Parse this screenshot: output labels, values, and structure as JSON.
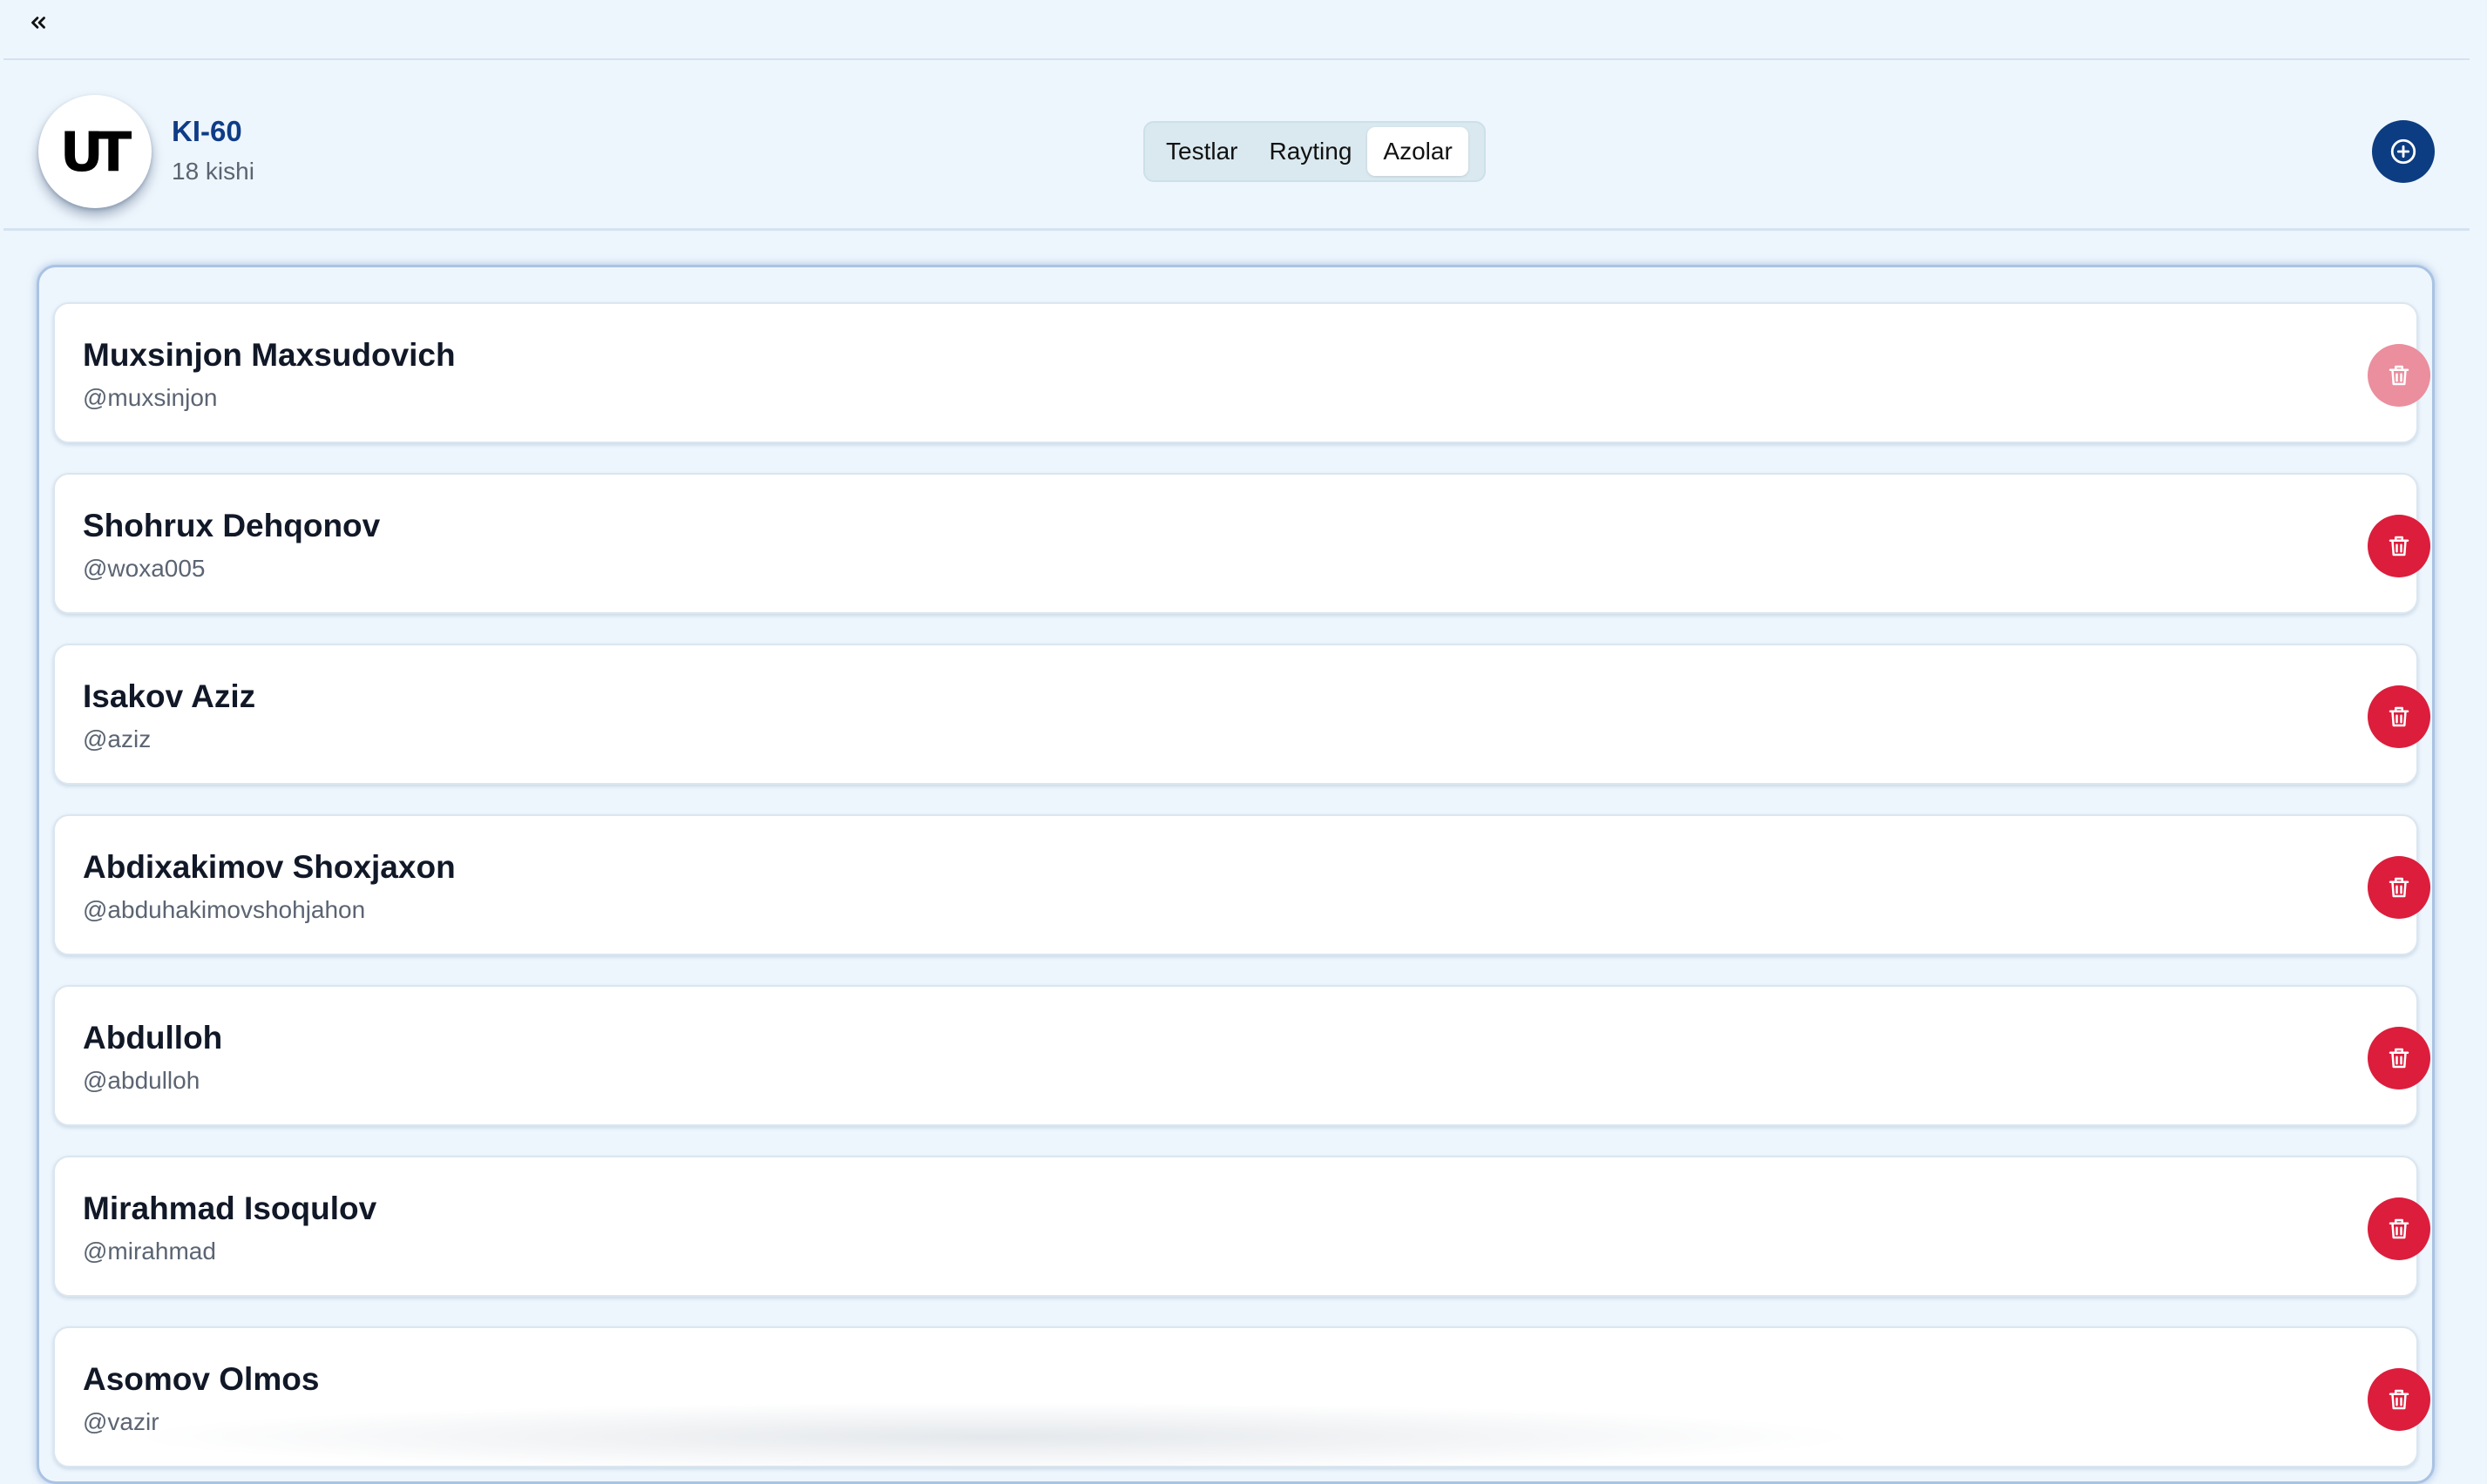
{
  "topbar": {
    "collapse_icon": "double-chevron-left-icon"
  },
  "group": {
    "logo_text": "UT",
    "name": "KI-60",
    "member_count": "18 kishi"
  },
  "tabs": [
    {
      "label": "Testlar",
      "active": false
    },
    {
      "label": "Rayting",
      "active": false
    },
    {
      "label": "Azolar",
      "active": true
    }
  ],
  "add_button": {
    "icon": "plus-circle-icon"
  },
  "members": [
    {
      "name": "Muxsinjon Maxsudovich",
      "username": "@muxsinjon",
      "delete_disabled": true
    },
    {
      "name": "Shohrux Dehqonov",
      "username": "@woxa005",
      "delete_disabled": false
    },
    {
      "name": "Isakov Aziz",
      "username": "@aziz",
      "delete_disabled": false
    },
    {
      "name": "Abdixakimov Shoxjaxon",
      "username": "@abduhakimovshohjahon",
      "delete_disabled": false
    },
    {
      "name": "Abdulloh",
      "username": "@abdulloh",
      "delete_disabled": false
    },
    {
      "name": "Mirahmad Isoqulov",
      "username": "@mirahmad",
      "delete_disabled": false
    },
    {
      "name": "Asomov Olmos",
      "username": "@vazir",
      "delete_disabled": false
    }
  ],
  "colors": {
    "accent": "#0c3d82",
    "delete": "#dc1d3c",
    "delete_disabled": "#eb8e9d",
    "background": "#eef6fd"
  }
}
